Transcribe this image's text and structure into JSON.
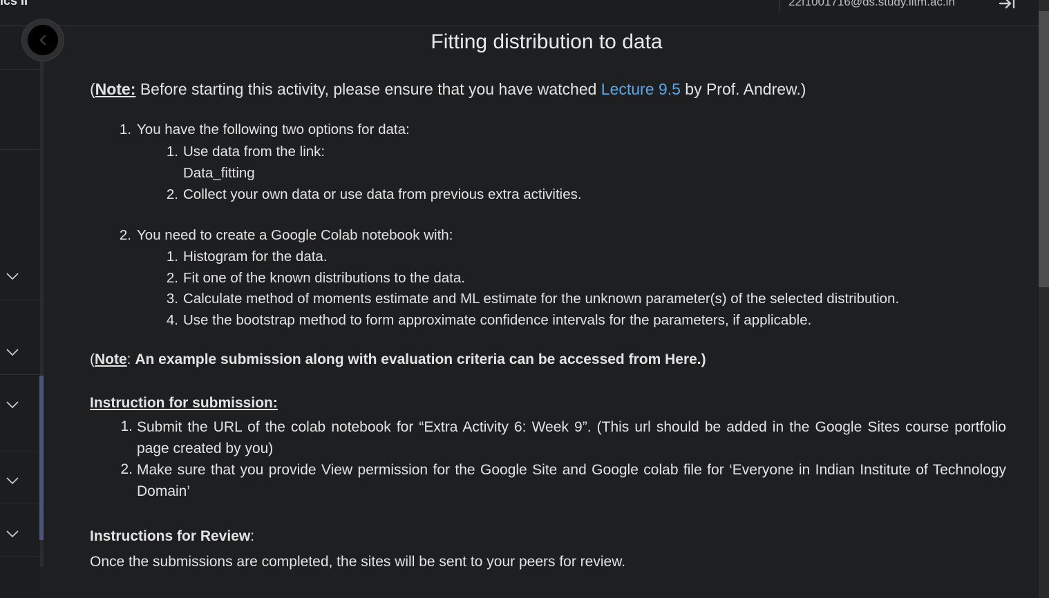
{
  "header": {
    "course_title": "ics II",
    "user_email": "22f1001716@ds.study.iitm.ac.in"
  },
  "page": {
    "title": "Fitting distribution to data",
    "note": {
      "open": "(",
      "label": "Note:",
      "text_before": " Before starting this activity, please ensure that you have watched ",
      "link": "Lecture 9.5",
      "text_after": " by Prof. Andrew.)"
    },
    "list": [
      {
        "num": "1.",
        "text": "You have the following two options for data:",
        "sub": [
          {
            "num": "1.",
            "text": "Use data from the link:",
            "link": "Data_fitting"
          },
          {
            "num": "2.",
            "text": "Collect your own data or use data from previous extra activities."
          }
        ]
      },
      {
        "num": "2.",
        "text": "You need to create a Google Colab notebook with:",
        "sub": [
          {
            "num": "1.",
            "text": "Histogram for the data."
          },
          {
            "num": "2.",
            "text": "Fit one of the known distributions to the data."
          },
          {
            "num": "3.",
            "text": "Calculate method of moments estimate and ML estimate for the unknown parameter(s) of the selected distribution."
          },
          {
            "num": "4.",
            "text": "Use the bootstrap method to form approximate confidence intervals for the parameters, if applicable."
          }
        ]
      }
    ],
    "note2": {
      "open": "(",
      "label": "Note",
      "colon": ": ",
      "text": "An example submission along with evaluation criteria can be accessed from ",
      "link": "Here",
      "close": ".)"
    },
    "submission": {
      "heading": "Instruction for submission:",
      "items": [
        {
          "num": "1.",
          "text": "Submit the URL of the colab notebook for “Extra Activity 6: Week 9”. (This url should be added in the Google Sites course portfolio page created by you)"
        },
        {
          "num": "2.",
          "text": "Make sure that you provide View permission for the Google Site  and  Google colab file for ‘Everyone in Indian Institute of Technology Domain’"
        }
      ]
    },
    "review": {
      "heading": "Instructions for Review",
      "colon": ":",
      "text": "Once the submissions are completed, the sites will be sent to your peers for review."
    }
  },
  "colors": {
    "background": "#1e1f21",
    "link": "#5aa6e8",
    "sidebar_progress": "#4a5578"
  },
  "icons": [
    "chevron-left-icon",
    "chevron-down-icon",
    "logout-icon"
  ]
}
